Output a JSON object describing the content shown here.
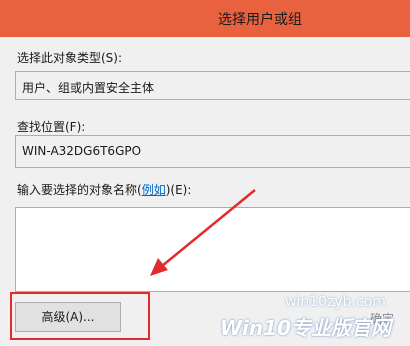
{
  "window": {
    "title": "选择用户或组"
  },
  "object_type": {
    "label": "选择此对象类型(S):",
    "value": "用户、组或内置安全主体"
  },
  "location": {
    "label": "查找位置(F):",
    "value": "WIN-A32DG6T6GPO"
  },
  "names": {
    "label_prefix": "输入要选择的对象名称(",
    "example_link": "例如",
    "label_suffix": ")(E):"
  },
  "buttons": {
    "advanced": "高级(A)...",
    "ok": "确定"
  },
  "watermark": {
    "line1": "win10zyb.com",
    "line2": "Win10专业版官网"
  },
  "annotation": {
    "highlight_color": "#e32b2b"
  }
}
